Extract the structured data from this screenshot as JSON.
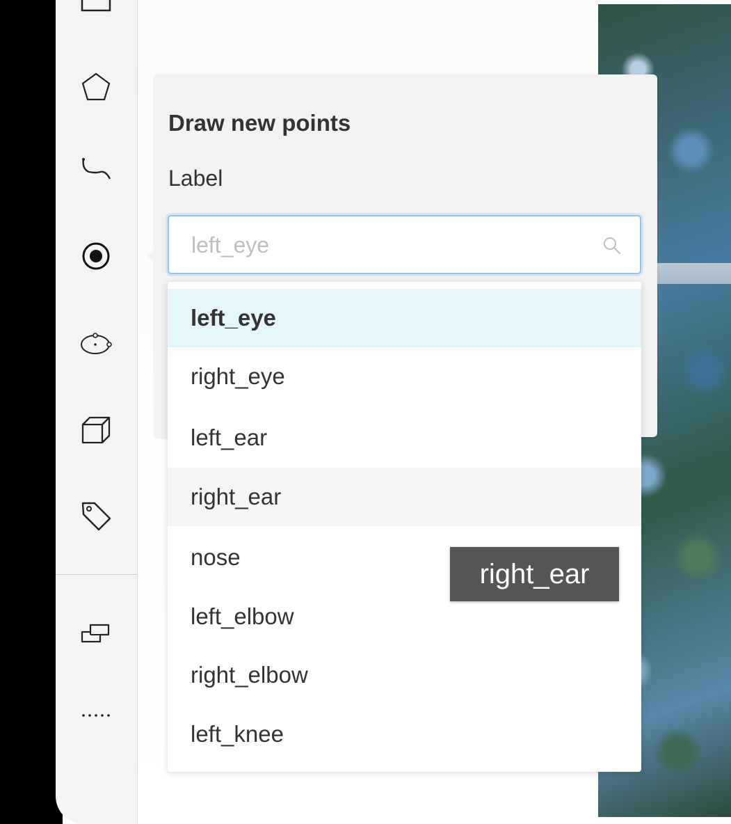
{
  "toolbar": {
    "tools": [
      {
        "name": "rectangle-icon"
      },
      {
        "name": "polygon-icon"
      },
      {
        "name": "polyline-icon"
      },
      {
        "name": "points-icon"
      },
      {
        "name": "ellipse-icon"
      },
      {
        "name": "cuboid-icon"
      },
      {
        "name": "tag-icon"
      },
      {
        "name": "group-icon"
      },
      {
        "name": "more-icon"
      }
    ]
  },
  "panel": {
    "title": "Draw new points",
    "label_heading": "Label",
    "search": {
      "value": "",
      "placeholder": "left_eye"
    },
    "options": [
      {
        "label": "left_eye",
        "state": "selected"
      },
      {
        "label": "right_eye",
        "state": "normal"
      },
      {
        "label": "left_ear",
        "state": "normal"
      },
      {
        "label": "right_ear",
        "state": "hovered"
      },
      {
        "label": "nose",
        "state": "normal"
      },
      {
        "label": "left_elbow",
        "state": "normal"
      },
      {
        "label": "right_elbow",
        "state": "normal"
      },
      {
        "label": "left_knee",
        "state": "normal"
      }
    ]
  },
  "tooltip": {
    "text": "right_ear"
  },
  "colors": {
    "selected_option_bg": "#e5f5fc",
    "search_focus_border": "#8fc3ea",
    "tooltip_bg": "#555555"
  }
}
